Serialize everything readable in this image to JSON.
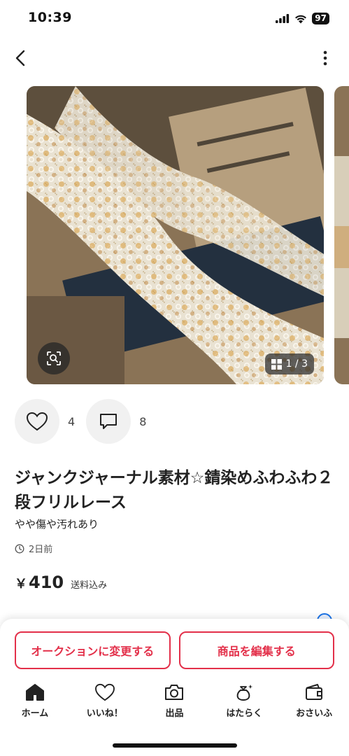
{
  "status": {
    "time": "10:39",
    "battery": "97",
    "signal_icon": "signal-icon",
    "wifi_icon": "wifi-icon"
  },
  "nav": {
    "back_icon": "chevron-left-icon",
    "more_icon": "vertical-dots-icon"
  },
  "gallery": {
    "counter": "1 / 3",
    "lens_icon": "image-search-icon",
    "grid_icon": "grid-icon",
    "photo_icon": "lace-ribbon-photo"
  },
  "actions": {
    "like_count": "4",
    "comment_count": "8",
    "like_icon": "heart-icon",
    "comment_icon": "comment-icon"
  },
  "item": {
    "title": "ジャンクジャーナル素材☆錆染めふわふわ２段フリルレース",
    "condition": "やや傷や汚れあり",
    "posted": "2日前",
    "price_symbol": "￥",
    "price": "410",
    "shipping_note": "送料込み"
  },
  "cta": {
    "auction": "オークションに変更する",
    "edit": "商品を編集する"
  },
  "tabs": [
    {
      "label": "ホーム",
      "icon": "home-icon"
    },
    {
      "label": "いいね！",
      "icon": "heart-icon"
    },
    {
      "label": "出品",
      "icon": "camera-icon"
    },
    {
      "label": "はたらく",
      "icon": "money-bag-icon"
    },
    {
      "label": "おさいふ",
      "icon": "wallet-icon"
    }
  ],
  "colors": {
    "accent": "#e3304a",
    "text": "#222222"
  }
}
